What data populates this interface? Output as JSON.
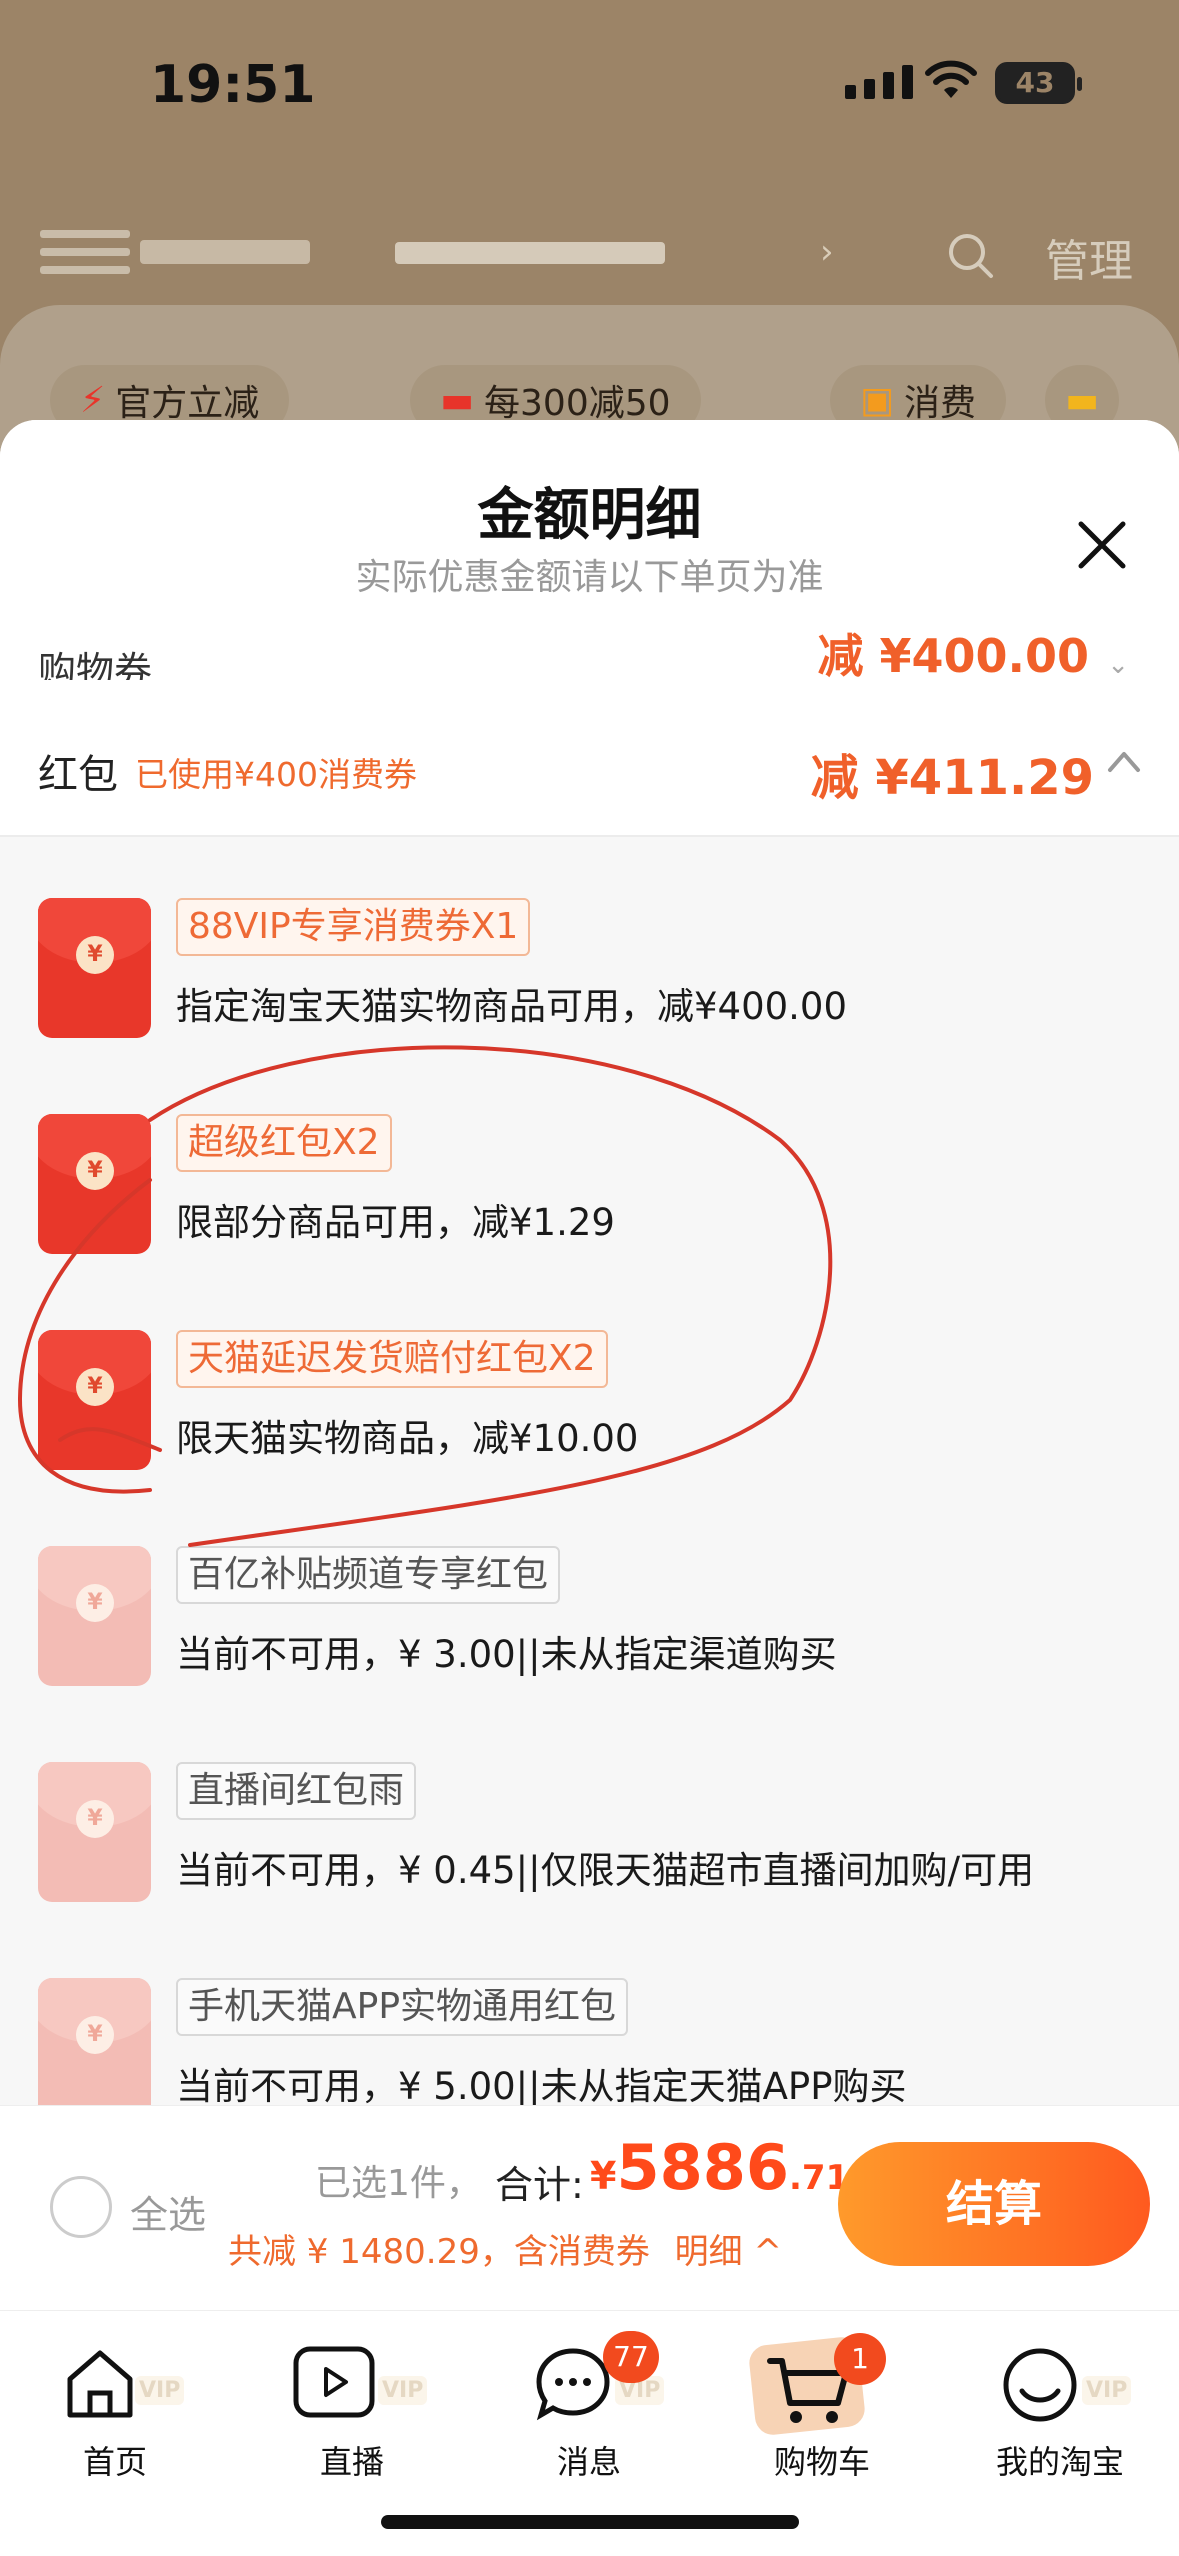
{
  "status_bar": {
    "time": "19:51",
    "battery": "43"
  },
  "header": {
    "manage": "管理",
    "arrow": "›"
  },
  "promo_tags": [
    "官方立减",
    "每300减50",
    "消费"
  ],
  "sheet": {
    "title": "金额明细",
    "subtitle": "实际优惠金额请以下单页为准",
    "shopping_voucher": {
      "label": "购物券",
      "value": "减 ¥400.00"
    },
    "red_packet": {
      "label": "红包",
      "used": "已使用¥400消费券",
      "value": "减 ¥411.29"
    },
    "items": [
      {
        "badge": "88VIP专享消费券X1",
        "desc": "指定淘宝天猫实物商品可用，减¥400.00",
        "available": true
      },
      {
        "badge": "超级红包X2",
        "desc": "限部分商品可用，减¥1.29",
        "available": true
      },
      {
        "badge": "天猫延迟发货赔付红包X2",
        "desc": "限天猫实物商品，减¥10.00",
        "available": true
      },
      {
        "badge": "百亿补贴频道专享红包",
        "desc": "当前不可用，¥ 3.00||未从指定渠道购买",
        "available": false
      },
      {
        "badge": "直播间红包雨",
        "desc": "当前不可用，¥ 0.45||仅限天猫超市直播间加购/可用",
        "available": false
      },
      {
        "badge": "手机天猫APP实物通用红包",
        "desc": "当前不可用，¥ 5.00||未从指定天猫APP购买",
        "available": false
      }
    ]
  },
  "checkout_bar": {
    "select_all": "全选",
    "selected": "已选1件，",
    "total_label": "合计:",
    "currency": "¥",
    "total_int": "5886",
    "total_dec": ".71",
    "saved": "共减 ¥ 1480.29，含消费券",
    "detail": "明细 ^",
    "checkout": "结算"
  },
  "tabbar": {
    "items": [
      {
        "label": "首页",
        "icon": "home-icon"
      },
      {
        "label": "直播",
        "icon": "live-icon"
      },
      {
        "label": "消息",
        "icon": "message-icon",
        "badge": "77"
      },
      {
        "label": "购物车",
        "icon": "cart-icon",
        "badge": "1"
      },
      {
        "label": "我的淘宝",
        "icon": "profile-icon"
      }
    ],
    "vip": "VIP"
  },
  "colors": {
    "accent": "#ff4a1a",
    "orange_text": "#ef6a2e",
    "annotation": "#d6372a"
  }
}
